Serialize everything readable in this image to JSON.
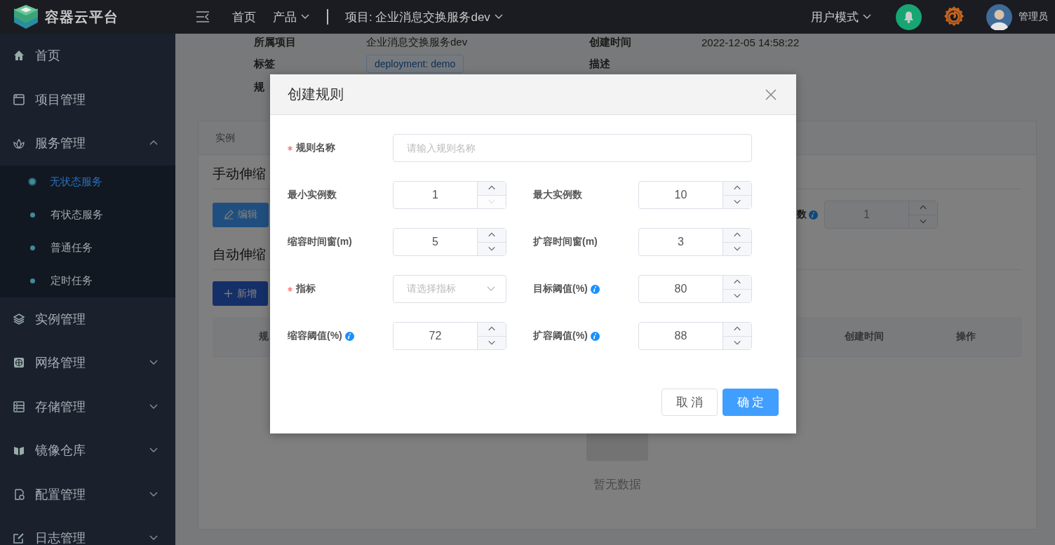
{
  "header": {
    "logo_text": "容器云平台",
    "nav": [
      {
        "label": "首页",
        "dropdown": false
      },
      {
        "label": "产品",
        "dropdown": true
      }
    ],
    "project": "项目: 企业消息交换服务dev",
    "user_mode": "用户模式",
    "user": "管理员"
  },
  "sidebar": {
    "items": [
      {
        "label": "首页",
        "kind": "link"
      },
      {
        "label": "项目管理",
        "kind": "link"
      },
      {
        "label": "服务管理",
        "kind": "group",
        "expanded": true,
        "children": [
          {
            "label": "无状态服务",
            "selected": true
          },
          {
            "label": "有状态服务",
            "selected": false
          },
          {
            "label": "普通任务",
            "selected": false
          },
          {
            "label": "定时任务",
            "selected": false
          }
        ]
      },
      {
        "label": "实例管理",
        "kind": "link"
      },
      {
        "label": "网络管理",
        "kind": "group",
        "expanded": false
      },
      {
        "label": "存储管理",
        "kind": "group",
        "expanded": false
      },
      {
        "label": "镜像仓库",
        "kind": "group",
        "expanded": false
      },
      {
        "label": "配置管理",
        "kind": "group",
        "expanded": false
      },
      {
        "label": "日志管理",
        "kind": "group",
        "expanded": false
      }
    ]
  },
  "details": {
    "fields": [
      {
        "label": "所属项目",
        "value": "企业消息交换服务dev"
      },
      {
        "label": "创建时间",
        "value": "2022-12-05 14:58:22"
      },
      {
        "label": "标签",
        "tag": "deployment: demo"
      },
      {
        "label": "描述"
      },
      {
        "label": "规"
      }
    ]
  },
  "card": {
    "tabs": [
      {
        "label": "实例",
        "selected": false
      }
    ],
    "manual_scaling": {
      "title": "手动伸缩",
      "edit_button": "编辑",
      "replicas_label": "数",
      "replicas_value": "1"
    },
    "auto_scaling": {
      "title": "自动伸缩",
      "add_button": "新增",
      "columns": [
        "规",
        "创建时间",
        "操作"
      ],
      "empty_text": "暂无数据"
    }
  },
  "dialog": {
    "title": "创建规则",
    "rows": [
      {
        "fields": [
          {
            "kind": "text",
            "label": "规则名称",
            "required": true,
            "placeholder": "请输入规则名称"
          }
        ]
      },
      {
        "fields": [
          {
            "kind": "number",
            "label": "最小实例数",
            "value": "1",
            "decrease_disabled": true
          },
          {
            "kind": "number",
            "label": "最大实例数",
            "value": "10",
            "decrease_disabled": false
          }
        ]
      },
      {
        "fields": [
          {
            "kind": "number",
            "label": "缩容时间窗(m)",
            "value": "5",
            "decrease_disabled": false
          },
          {
            "kind": "number",
            "label": "扩容时间窗(m)",
            "value": "3",
            "decrease_disabled": false
          }
        ]
      },
      {
        "fields": [
          {
            "kind": "select",
            "label": "指标",
            "required": true,
            "placeholder": "请选择指标"
          },
          {
            "kind": "number",
            "label": "目标阈值(%)",
            "info": true,
            "value": "80",
            "decrease_disabled": false
          }
        ]
      },
      {
        "fields": [
          {
            "kind": "number",
            "label": "缩容阈值(%)",
            "info": true,
            "value": "72",
            "decrease_disabled": false
          },
          {
            "kind": "number",
            "label": "扩容阈值(%)",
            "info": true,
            "value": "88",
            "decrease_disabled": false
          }
        ]
      }
    ],
    "buttons": [
      {
        "label": "取 消",
        "kind": "default"
      },
      {
        "label": "确 定",
        "kind": "primary"
      }
    ]
  }
}
